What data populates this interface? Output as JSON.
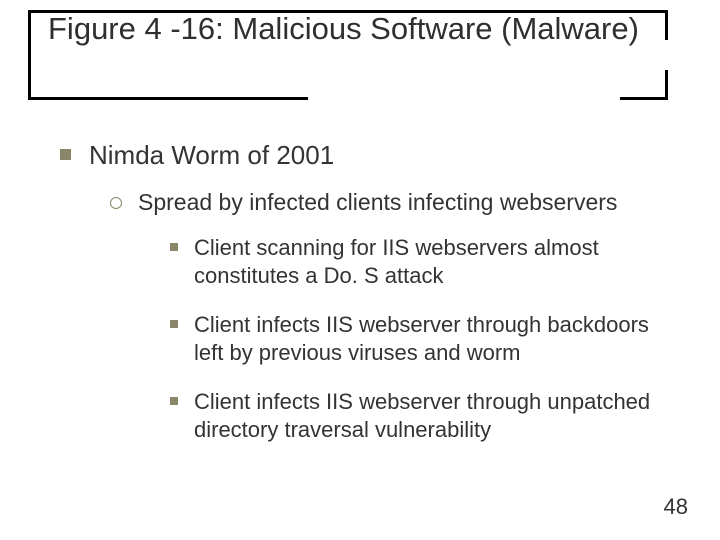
{
  "title": "Figure 4 -16: Malicious Software (Malware)",
  "lvl1": "Nimda Worm of 2001",
  "lvl2": "Spread by infected clients infecting webservers",
  "points": [
    "Client scanning for IIS webservers almost constitutes a Do. S attack",
    "Client infects IIS webserver through backdoors left by previous viruses and worm",
    "Client infects IIS webserver through unpatched directory traversal vulnerability"
  ],
  "page_number": "48"
}
